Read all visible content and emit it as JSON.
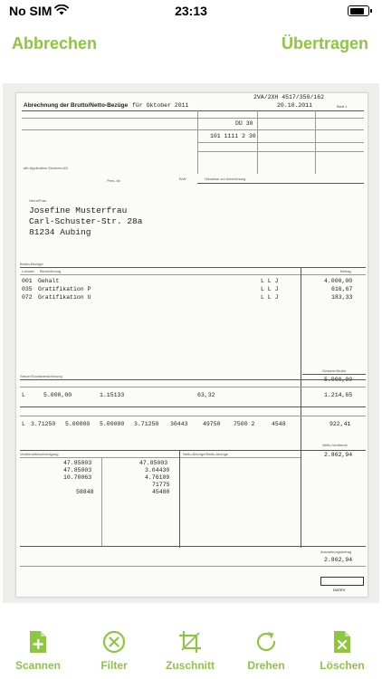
{
  "status_bar": {
    "carrier": "No SIM",
    "time": "23:13",
    "battery_level": 0.85
  },
  "nav": {
    "cancel_label": "Abbrechen",
    "transfer_label": "Übertragen"
  },
  "document": {
    "title": "Abrechnung der Brutto/Netto-Bezüge",
    "period": "für Oktober 2011",
    "doc_code": "2VA/2XH 4517/350/162",
    "doc_date": "20.10.2011",
    "blatt": "Blatt 1",
    "line_du": "DÜ 30",
    "line_101": "101 1111 2 30",
    "pers_nr": "Pers.-Nr.",
    "ab": "B/W",
    "hinweise": "Hinweise zur Abrechnung",
    "company": "afb Application Services AG",
    "salutation": "Herrn/Frau",
    "recipient_name": "Josefine Musterfrau",
    "recipient_street": "Carl-Schuster-Str. 28a",
    "recipient_city": "81234 Aubing",
    "section_brutto": "Brutto-Bezüge",
    "col_lohnart": "Lohnart",
    "col_bezeichnung": "Bezeichnung",
    "col_betrag": "Betrag",
    "items": [
      {
        "code": "001",
        "text": "Gehalt",
        "flags": "L L J",
        "amount": "4.000,00"
      },
      {
        "code": "035",
        "text": "Gratifikation P",
        "flags": "L L J",
        "amount": "616,67"
      },
      {
        "code": "072",
        "text": "Gratifikation U",
        "flags": "L L J",
        "amount": "183,33"
      }
    ],
    "gesamt_brutto_label": "Gesamt-Brutto",
    "gesamt_brutto": "5.000,00",
    "steuer_label": "Steuer/Sozialversicherung",
    "steuer_brutto": "5.000,00",
    "lohnsteuer": "1.15133",
    "soli": "63,32",
    "steuer_row_code": "L",
    "steuer_total": "1.214,65",
    "sv_code": "L",
    "sv_values": [
      "3.71250",
      "5.00000",
      "5.00000",
      "3.71250",
      "30443",
      "49750",
      "7500 2",
      "4548"
    ],
    "sv_total": "922,41",
    "netto_label": "Netto-Verdienst",
    "netto": "2.862,94",
    "verdienst_label": "Verdienstbescheinigung",
    "verdienst_left": [
      "47.85003",
      "47.85003",
      "10.70063",
      "58848"
    ],
    "verdienst_right": [
      "47.85003",
      "3.04430",
      "4.76109",
      "71775",
      "45480"
    ],
    "netto_bezuege_label": "Netto-Bezüge/Netto-Abzüge",
    "auszahlung_label": "Auszahlungsbetrag",
    "auszahlung": "2.862,94",
    "footer_brand": "DATEV"
  },
  "toolbar": {
    "scan_label": "Scannen",
    "filter_label": "Filter",
    "crop_label": "Zuschnitt",
    "rotate_label": "Drehen",
    "delete_label": "Löschen"
  },
  "colors": {
    "accent": "#8dc63f"
  }
}
